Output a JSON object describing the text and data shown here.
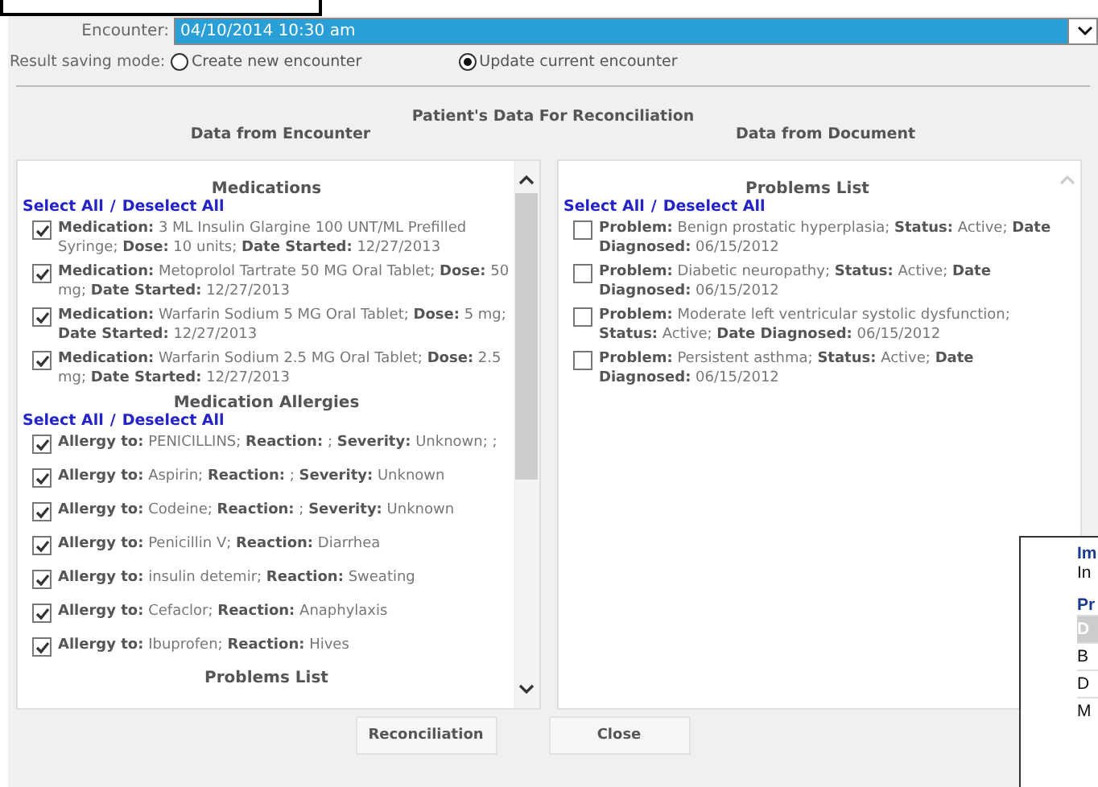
{
  "encounter": {
    "label": "Encounter:",
    "value": "04/10/2014 10:30 am"
  },
  "saving_mode": {
    "label": "Result saving mode:",
    "options": [
      {
        "label": "Create new encounter",
        "selected": false
      },
      {
        "label": "Update current encounter",
        "selected": true
      }
    ]
  },
  "title": "Patient's Data For Reconciliation",
  "left": {
    "heading": "Data from Encounter",
    "sections": [
      {
        "title": "Medications",
        "select_all": "Select All",
        "separator": "/",
        "deselect_all": "Deselect All",
        "items": [
          {
            "text": "**Medication:** 3 ML Insulin Glargine 100 UNT/ML Prefilled Syringe; **Dose:** 10 units; **Date Started:** 12/27/2013",
            "checked": true
          },
          {
            "text": "**Medication:** Metoprolol Tartrate 50 MG Oral Tablet; **Dose:** 50 mg; **Date Started:** 12/27/2013",
            "checked": true
          },
          {
            "text": "**Medication:** Warfarin Sodium 5 MG Oral Tablet; **Dose:** 5 mg; **Date Started:** 12/27/2013",
            "checked": true
          },
          {
            "text": "**Medication:** Warfarin Sodium 2.5 MG Oral Tablet; **Dose:** 2.5 mg; **Date Started:** 12/27/2013",
            "checked": true
          }
        ]
      },
      {
        "title": "Medication Allergies",
        "select_all": "Select All",
        "separator": "/",
        "deselect_all": "Deselect All",
        "items": [
          {
            "text": "**Allergy to:** PENICILLINS; **Reaction:** ; **Severity:** Unknown; ;",
            "checked": true
          },
          {
            "text": "**Allergy to:** Aspirin; **Reaction:** ; **Severity:** Unknown",
            "checked": true
          },
          {
            "text": "**Allergy to:** Codeine; **Reaction:** ; **Severity:** Unknown",
            "checked": true
          },
          {
            "text": "**Allergy to:** Penicillin V; **Reaction:** Diarrhea",
            "checked": true
          },
          {
            "text": "**Allergy to:** insulin detemir; **Reaction:** Sweating",
            "checked": true
          },
          {
            "text": "**Allergy to:** Cefaclor; **Reaction:** Anaphylaxis",
            "checked": true
          },
          {
            "text": "**Allergy to:** Ibuprofen; **Reaction:** Hives",
            "checked": true
          }
        ]
      },
      {
        "title": "Problems List"
      }
    ]
  },
  "right": {
    "heading": "Data from Document",
    "sections": [
      {
        "title": "Problems List",
        "select_all": "Select All",
        "separator": "/",
        "deselect_all": "Deselect All",
        "items": [
          {
            "text": "**Problem:** Benign prostatic hyperplasia; **Status:** Active; **Date Diagnosed:** 06/15/2012",
            "checked": false
          },
          {
            "text": "**Problem:** Diabetic neuropathy; **Status:** Active; **Date Diagnosed:** 06/15/2012",
            "checked": false
          },
          {
            "text": "**Problem:** Moderate left ventricular systolic dysfunction; **Status:** Active; **Date Diagnosed:** 06/15/2012",
            "checked": false
          },
          {
            "text": "**Problem:** Persistent asthma; **Status:** Active; **Date Diagnosed:** 06/15/2012",
            "checked": false
          }
        ]
      }
    ]
  },
  "buttons": [
    "Reconciliation",
    "Close"
  ],
  "overlay": {
    "heading_1": "Im",
    "text_1": "In",
    "heading_2": "Pr",
    "rows": [
      "D",
      "B",
      "D",
      "M"
    ]
  }
}
